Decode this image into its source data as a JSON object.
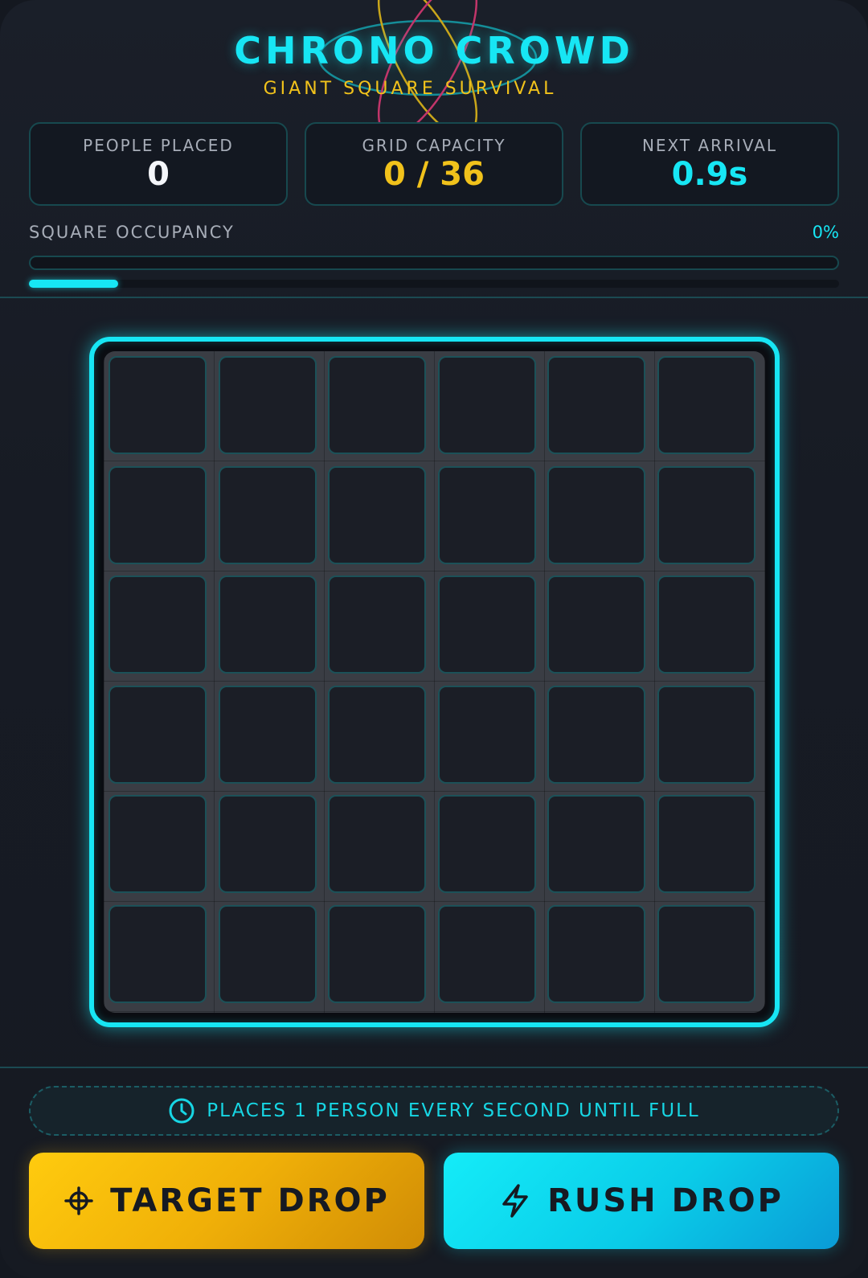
{
  "header": {
    "title": "CHRONO CROWD",
    "subtitle": "GIANT SQUARE SURVIVAL"
  },
  "stats": {
    "people_placed": {
      "label": "PEOPLE PLACED",
      "value": "0"
    },
    "grid_capacity": {
      "label": "GRID CAPACITY",
      "value": "0 / 36"
    },
    "next_arrival": {
      "label": "NEXT ARRIVAL",
      "value": "0.9s"
    }
  },
  "occupancy": {
    "label": "SQUARE OCCUPANCY",
    "value": "0%",
    "timer_fraction": 0.11
  },
  "board": {
    "rows": 6,
    "cols": 6,
    "occupied": []
  },
  "info": {
    "icon": "clock-icon",
    "text": "PLACES 1 PERSON EVERY SECOND UNTIL FULL"
  },
  "actions": {
    "target_drop": {
      "label": "TARGET DROP",
      "icon": "crosshair-icon"
    },
    "rush_drop": {
      "label": "RUSH DROP",
      "icon": "lightning-icon"
    }
  },
  "colors": {
    "accent_cyan": "#17e6f4",
    "accent_yellow": "#f1c21b",
    "background": "#171b24"
  }
}
